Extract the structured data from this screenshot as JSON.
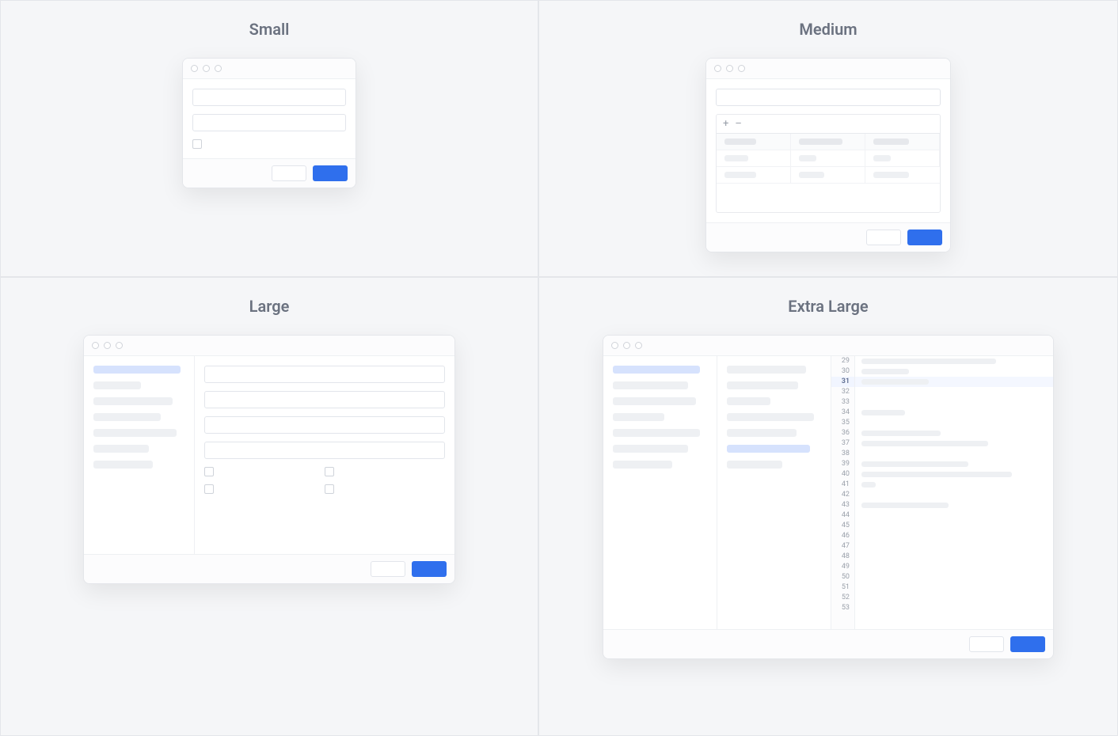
{
  "quadrants": {
    "small": {
      "title": "Small"
    },
    "medium": {
      "title": "Medium"
    },
    "large": {
      "title": "Large"
    },
    "xl": {
      "title": "Extra Large"
    }
  },
  "medium": {
    "toolbar": {
      "add": "+",
      "remove": "–"
    }
  },
  "xl": {
    "line_numbers": [
      29,
      30,
      31,
      32,
      33,
      34,
      35,
      36,
      37,
      38,
      39,
      40,
      41,
      42,
      43,
      44,
      45,
      46,
      47,
      48,
      49,
      50,
      51,
      52,
      53
    ],
    "highlighted_line": 31,
    "col_a_widths": [
      110,
      95,
      105,
      65,
      110,
      95,
      75
    ],
    "col_b_widths": [
      100,
      90,
      55,
      110,
      88,
      105,
      70
    ],
    "col_a_active": 0,
    "col_b_active": 5,
    "code_widths": {
      "29": 170,
      "30": 60,
      "31": 85,
      "32": 0,
      "33": 0,
      "34": 55,
      "35": 0,
      "36": 100,
      "37": 160,
      "38": 0,
      "39": 135,
      "40": 190,
      "41": 18,
      "42": 0,
      "43": 110,
      "44": 0,
      "45": 0,
      "46": 0,
      "47": 0,
      "48": 0
    }
  }
}
